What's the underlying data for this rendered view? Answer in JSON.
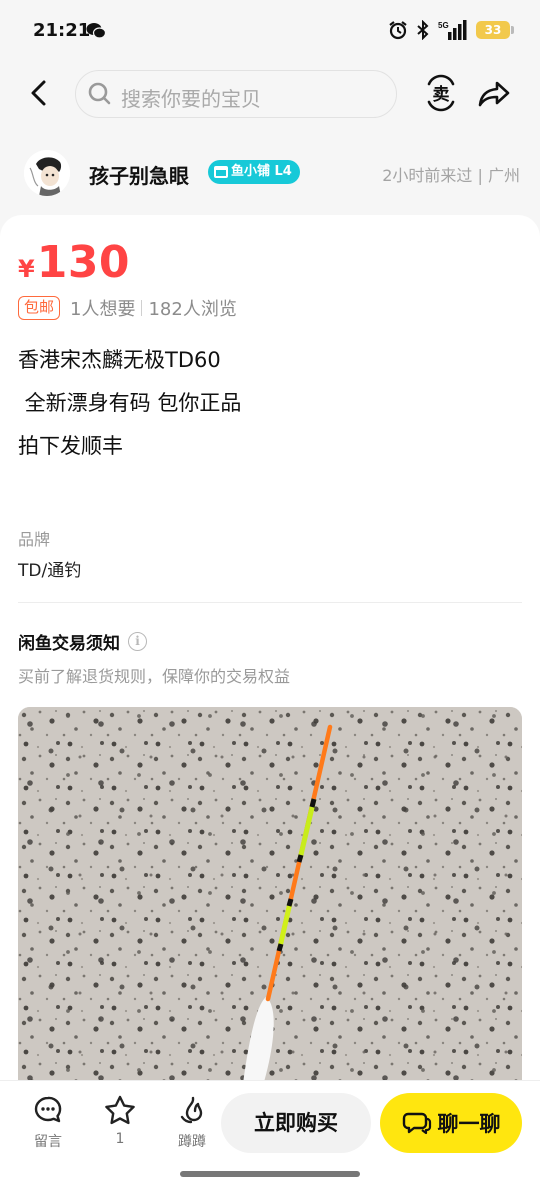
{
  "status_bar": {
    "time": "21:21",
    "network": "5G",
    "battery": "33"
  },
  "nav": {
    "search_placeholder": "搜索你要的宝贝",
    "sell_icon_text": "卖"
  },
  "seller": {
    "name": "孩子别急眼",
    "level_badge": "鱼小铺 L4",
    "last_active": "2小时前来过 | 广州"
  },
  "product": {
    "currency": "¥",
    "price": "130",
    "free_shipping_badge": "包邮",
    "wants": "1人想要",
    "views": "182人浏览",
    "description": "香港宋杰麟无极TD60\n 全新漂身有码 包你正品\n拍下发顺丰",
    "brand_label": "品牌",
    "brand_value": "TD/通钓"
  },
  "notice": {
    "title": "闲鱼交易须知",
    "subtitle": "买前了解退货规则，保障你的交易权益"
  },
  "bottom_bar": {
    "comment_label": "留言",
    "favorite_count": "1",
    "boost_label": "蹲蹲",
    "buy_label": "立即购买",
    "chat_label": "聊一聊"
  },
  "colors": {
    "price": "#ff4444",
    "chat_button": "#ffe60f",
    "level_badge": "#17c9d8",
    "free_shipping": "#ff6a3d"
  }
}
